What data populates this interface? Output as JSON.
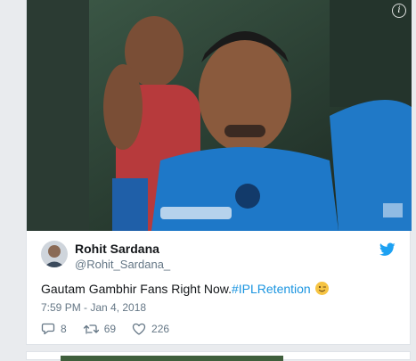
{
  "tweet": {
    "media_alt": "Cricket team members sitting in the dugout",
    "author": {
      "name": "Rohit Sardana",
      "handle": "@Rohit_Sardana_"
    },
    "text_prefix": "Gautam Gambhir Fans Right Now.",
    "hashtag": "#IPLRetention",
    "emoji": "winking-face",
    "timestamp": "7:59 PM - Jan 4, 2018",
    "actions": {
      "replies": "8",
      "retweets": "69",
      "likes": "226"
    },
    "info_icon": "info-icon",
    "brand_icon": "twitter-bird-icon"
  },
  "colors": {
    "brand": "#1da1f2",
    "hashtag": "#1b95e0",
    "muted": "#657786",
    "text": "#14171a"
  }
}
